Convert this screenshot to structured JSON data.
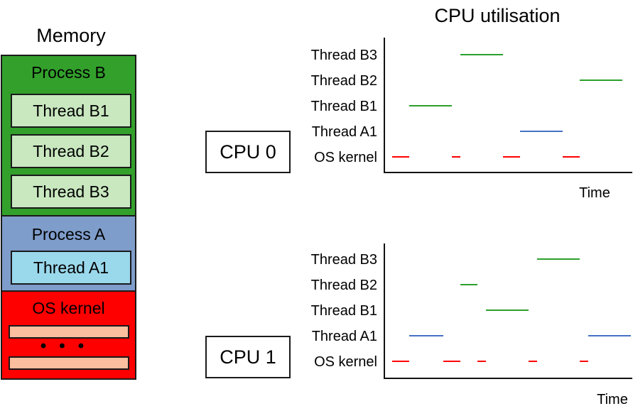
{
  "memory": {
    "title": "Memory",
    "process_b": {
      "label": "Process B",
      "color": "#33a02c",
      "threads": [
        "Thread B1",
        "Thread B2",
        "Thread B3"
      ]
    },
    "process_a": {
      "label": "Process A",
      "color": "#7f9dca",
      "threads": [
        "Thread A1"
      ]
    },
    "os_kernel": {
      "label": "OS kernel",
      "color": "#ff0000",
      "ellipsis": "..."
    }
  },
  "cpus": [
    {
      "label": "CPU 0"
    },
    {
      "label": "CPU 1"
    }
  ],
  "chart_data": [
    {
      "type": "timeline",
      "title": "CPU utilisation",
      "cpu": "CPU 0",
      "xlabel": "Time",
      "ylabel": "",
      "xlim": [
        0,
        29
      ],
      "rows": [
        "Thread B3",
        "Thread B2",
        "Thread B1",
        "Thread A1",
        "OS kernel"
      ],
      "colors": {
        "Thread B3": "#2ca02c",
        "Thread B2": "#2ca02c",
        "Thread B1": "#2ca02c",
        "Thread A1": "#4472c4",
        "OS kernel": "#ff0000"
      },
      "segments": [
        {
          "row": "OS kernel",
          "start": 1,
          "end": 3
        },
        {
          "row": "Thread B1",
          "start": 3,
          "end": 8
        },
        {
          "row": "OS kernel",
          "start": 8,
          "end": 9
        },
        {
          "row": "Thread B3",
          "start": 9,
          "end": 14
        },
        {
          "row": "OS kernel",
          "start": 14,
          "end": 16
        },
        {
          "row": "Thread A1",
          "start": 16,
          "end": 21
        },
        {
          "row": "OS kernel",
          "start": 21,
          "end": 23
        },
        {
          "row": "Thread B2",
          "start": 23,
          "end": 28
        }
      ]
    },
    {
      "type": "timeline",
      "title": "",
      "cpu": "CPU 1",
      "xlabel": "Time",
      "ylabel": "",
      "xlim": [
        0,
        29
      ],
      "rows": [
        "Thread B3",
        "Thread B2",
        "Thread B1",
        "Thread A1",
        "OS kernel"
      ],
      "colors": {
        "Thread B3": "#2ca02c",
        "Thread B2": "#2ca02c",
        "Thread B1": "#2ca02c",
        "Thread A1": "#4472c4",
        "OS kernel": "#ff0000"
      },
      "segments": [
        {
          "row": "OS kernel",
          "start": 1,
          "end": 3
        },
        {
          "row": "Thread A1",
          "start": 3,
          "end": 7
        },
        {
          "row": "OS kernel",
          "start": 7,
          "end": 9
        },
        {
          "row": "Thread B2",
          "start": 9,
          "end": 11
        },
        {
          "row": "OS kernel",
          "start": 11,
          "end": 12
        },
        {
          "row": "Thread B1",
          "start": 12,
          "end": 17
        },
        {
          "row": "OS kernel",
          "start": 17,
          "end": 18
        },
        {
          "row": "Thread B3",
          "start": 18,
          "end": 23
        },
        {
          "row": "OS kernel",
          "start": 23,
          "end": 24
        },
        {
          "row": "Thread A1",
          "start": 24,
          "end": 29
        }
      ]
    }
  ]
}
